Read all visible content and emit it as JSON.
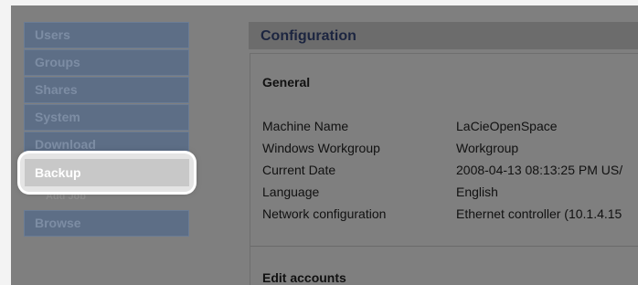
{
  "sidebar": {
    "items": [
      {
        "label": "Users"
      },
      {
        "label": "Groups"
      },
      {
        "label": "Shares"
      },
      {
        "label": "System"
      },
      {
        "label": "Download"
      }
    ],
    "active": {
      "label": "Backup"
    },
    "sub_item": {
      "label": "Add Job"
    },
    "after": {
      "label": "Browse"
    }
  },
  "panel": {
    "title": "Configuration",
    "general_title": "General",
    "rows": [
      {
        "key": "Machine Name",
        "value": "LaCieOpenSpace"
      },
      {
        "key": "Windows Workgroup",
        "value": "Workgroup"
      },
      {
        "key": "Current Date",
        "value": "2008-04-13 08:13:25 PM US/"
      },
      {
        "key": "Language",
        "value": "English"
      },
      {
        "key": "Network configuration",
        "value": "Ethernet controller (10.1.4.15"
      }
    ],
    "edit_accounts_title": "Edit accounts"
  }
}
